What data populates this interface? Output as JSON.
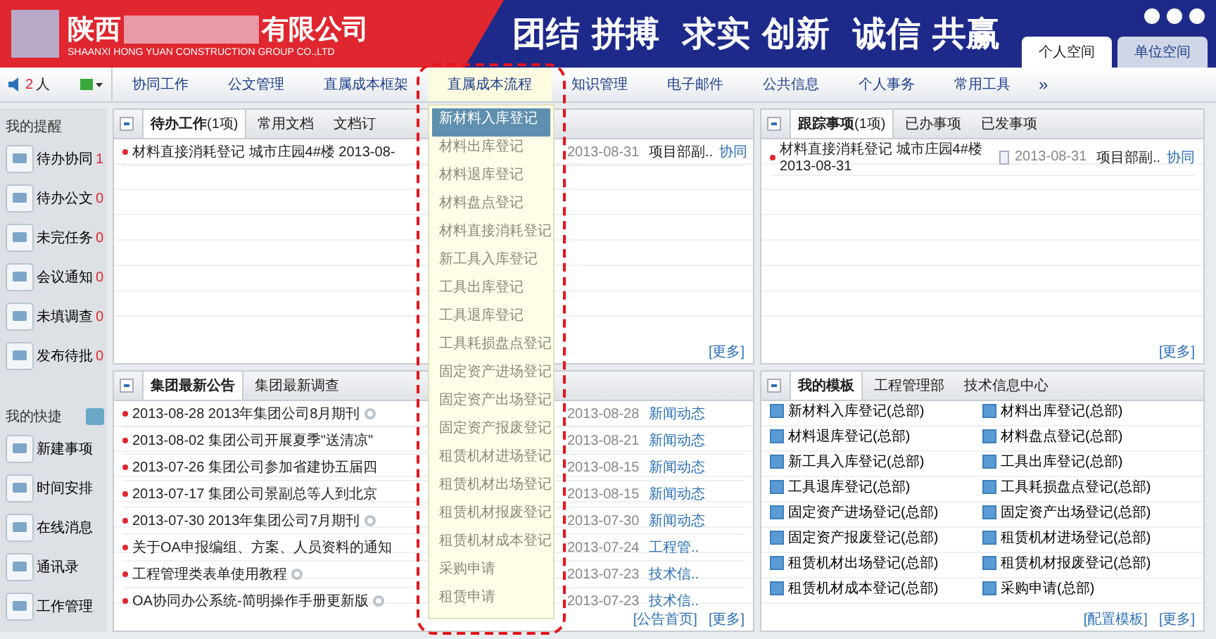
{
  "header": {
    "company_prefix": "陕西",
    "company_suffix": "有限公司",
    "company_english": "SHAANXI HONG YUAN CONSTRUCTION GROUP CO.,LTD",
    "slogan": "团结 拼搏  求实 创新  诚信 共赢",
    "space_tabs": [
      {
        "label": "个人空间",
        "selected": true
      },
      {
        "label": "单位空间",
        "selected": false
      }
    ]
  },
  "online": {
    "count": "2",
    "unit": "人"
  },
  "nav": {
    "items": [
      {
        "label": "协同工作",
        "selected": false
      },
      {
        "label": "公文管理",
        "selected": false
      },
      {
        "label": "直属成本框架",
        "selected": false
      },
      {
        "label": "直属成本流程",
        "selected": true
      },
      {
        "label": "知识管理",
        "selected": false
      },
      {
        "label": "电子邮件",
        "selected": false
      },
      {
        "label": "公共信息",
        "selected": false
      },
      {
        "label": "个人事务",
        "selected": false
      },
      {
        "label": "常用工具",
        "selected": false
      }
    ],
    "more": "»"
  },
  "dropdown": {
    "items": [
      {
        "label": "新材料入库登记",
        "selected": true
      },
      {
        "label": "材料出库登记",
        "selected": false
      },
      {
        "label": "材料退库登记",
        "selected": false
      },
      {
        "label": "材料盘点登记",
        "selected": false
      },
      {
        "label": "材料直接消耗登记",
        "selected": false
      },
      {
        "label": "新工具入库登记",
        "selected": false
      },
      {
        "label": "工具出库登记",
        "selected": false
      },
      {
        "label": "工具退库登记",
        "selected": false
      },
      {
        "label": "工具耗损盘点登记",
        "selected": false
      },
      {
        "label": "固定资产进场登记",
        "selected": false
      },
      {
        "label": "固定资产出场登记",
        "selected": false
      },
      {
        "label": "固定资产报废登记",
        "selected": false
      },
      {
        "label": "租赁机材进场登记",
        "selected": false
      },
      {
        "label": "租赁机材出场登记",
        "selected": false
      },
      {
        "label": "租赁机材报废登记",
        "selected": false
      },
      {
        "label": "租赁机材成本登记",
        "selected": false
      },
      {
        "label": "采购申请",
        "selected": false
      },
      {
        "label": "租赁申请",
        "selected": false
      }
    ]
  },
  "sidebar": {
    "reminders": {
      "title": "我的提醒",
      "items": [
        {
          "label": "待办协同",
          "count": "1"
        },
        {
          "label": "待办公文",
          "count": "0"
        },
        {
          "label": "未完任务",
          "count": "0"
        },
        {
          "label": "会议通知",
          "count": "0"
        },
        {
          "label": "未填调查",
          "count": "0"
        },
        {
          "label": "发布待批",
          "count": "0"
        }
      ]
    },
    "shortcuts": {
      "title": "我的快捷",
      "items": [
        {
          "label": "新建事项"
        },
        {
          "label": "时间安排"
        },
        {
          "label": "在线消息"
        },
        {
          "label": "通讯录"
        },
        {
          "label": "工作管理"
        }
      ]
    }
  },
  "todo_panel": {
    "tabs": [
      {
        "label": "待办工作",
        "count": "(1项)",
        "selected": true
      },
      {
        "label": "常用文档",
        "selected": false
      },
      {
        "label": "文档订",
        "selected": false
      }
    ],
    "rows": [
      {
        "title": "材料直接消耗登记 城市庄园4#楼 2013-08-",
        "date": "2013-08-31",
        "sender": "项目部副..",
        "category": "协同"
      }
    ],
    "footer": [
      "[更多]"
    ]
  },
  "tracking_panel": {
    "tabs": [
      {
        "label": "跟踪事项",
        "count": "(1项)",
        "selected": true
      },
      {
        "label": "已办事项",
        "selected": false
      },
      {
        "label": "已发事项",
        "selected": false
      }
    ],
    "rows": [
      {
        "title": "材料直接消耗登记 城市庄园4#楼 2013-08-31",
        "note": true,
        "date": "2013-08-31",
        "sender": "项目部副..",
        "category": "协同"
      }
    ],
    "footer": [
      "[更多]"
    ]
  },
  "news_panel": {
    "tabs": [
      {
        "label": "集团最新公告",
        "selected": true
      },
      {
        "label": "集团最新调查",
        "selected": false
      }
    ],
    "rows": [
      {
        "title": "2013-08-28 2013年集团公司8月期刊",
        "attachment": true,
        "date": "2013-08-28",
        "category": "新闻动态"
      },
      {
        "title": "2013-08-02 集团公司开展夏季\"送清凉\"",
        "attachment": false,
        "date": "2013-08-21",
        "category": "新闻动态"
      },
      {
        "title": "2013-07-26 集团公司参加省建协五届四",
        "attachment": false,
        "date": "2013-08-15",
        "category": "新闻动态"
      },
      {
        "title": "2013-07-17 集团公司景副总等人到北京",
        "attachment": false,
        "date": "2013-08-15",
        "category": "新闻动态"
      },
      {
        "title": "2013-07-30 2013年集团公司7月期刊",
        "attachment": true,
        "date": "2013-07-30",
        "category": "新闻动态"
      },
      {
        "title": "关于OA申报编组、方案、人员资料的通知",
        "attachment": false,
        "date": "2013-07-24",
        "category": "工程管.."
      },
      {
        "title": "工程管理类表单使用教程",
        "attachment": true,
        "date": "2013-07-23",
        "category": "技术信.."
      },
      {
        "title": "OA协同办公系统-简明操作手册更新版",
        "attachment": true,
        "date": "2013-07-23",
        "category": "技术信.."
      }
    ],
    "footer": [
      "[公告首页]",
      "[更多]"
    ]
  },
  "template_panel": {
    "tabs": [
      {
        "label": "我的模板",
        "selected": true
      },
      {
        "label": "工程管理部",
        "selected": false
      },
      {
        "label": "技术信息中心",
        "selected": false
      }
    ],
    "items": [
      "新材料入库登记(总部)",
      "材料出库登记(总部)",
      "材料退库登记(总部)",
      "材料盘点登记(总部)",
      "新工具入库登记(总部)",
      "工具出库登记(总部)",
      "工具退库登记(总部)",
      "工具耗损盘点登记(总部)",
      "固定资产进场登记(总部)",
      "固定资产出场登记(总部)",
      "固定资产报废登记(总部)",
      "租赁机材进场登记(总部)",
      "租赁机材出场登记(总部)",
      "租赁机材报废登记(总部)",
      "租赁机材成本登记(总部)",
      "采购申请(总部)"
    ],
    "footer": [
      "[配置模板]",
      "[更多]"
    ]
  }
}
